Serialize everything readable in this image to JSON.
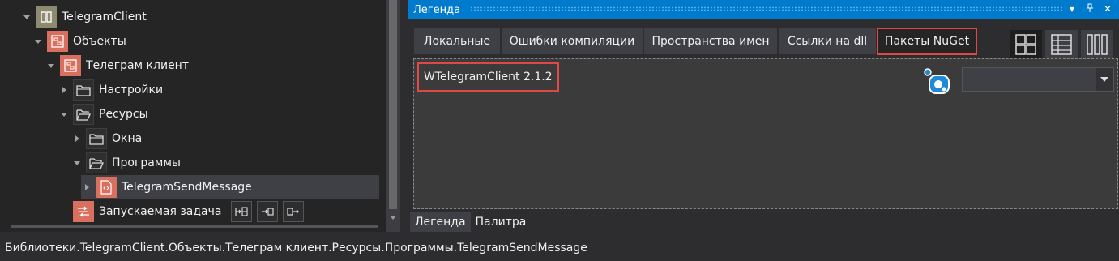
{
  "tree": {
    "items": [
      {
        "label": "TelegramClient"
      },
      {
        "label": "Объекты"
      },
      {
        "label": "Телеграм клиент"
      },
      {
        "label": "Настройки"
      },
      {
        "label": "Ресурсы"
      },
      {
        "label": "Окна"
      },
      {
        "label": "Программы"
      },
      {
        "label": "TelegramSendMessage"
      },
      {
        "label": "Запускаемая задача"
      }
    ]
  },
  "legend": {
    "title": "Легенда",
    "tabs": [
      {
        "label": "Локальные"
      },
      {
        "label": "Ошибки компиляции"
      },
      {
        "label": "Пространства имен"
      },
      {
        "label": "Ссылки на dll"
      },
      {
        "label": "Пакеты NuGet"
      }
    ],
    "package": "WTelegramClient 2.1.2",
    "combo_value": "",
    "bottom_tabs": [
      {
        "label": "Легенда"
      },
      {
        "label": "Палитра"
      }
    ]
  },
  "status": {
    "path": "Библиотеки.TelegramClient.Объекты.Телеграм клиент.Ресурсы.Программы.TelegramSendMessage"
  },
  "colors": {
    "accent": "#007acc",
    "highlight": "#e04848",
    "object_icon": "#d9705f"
  }
}
